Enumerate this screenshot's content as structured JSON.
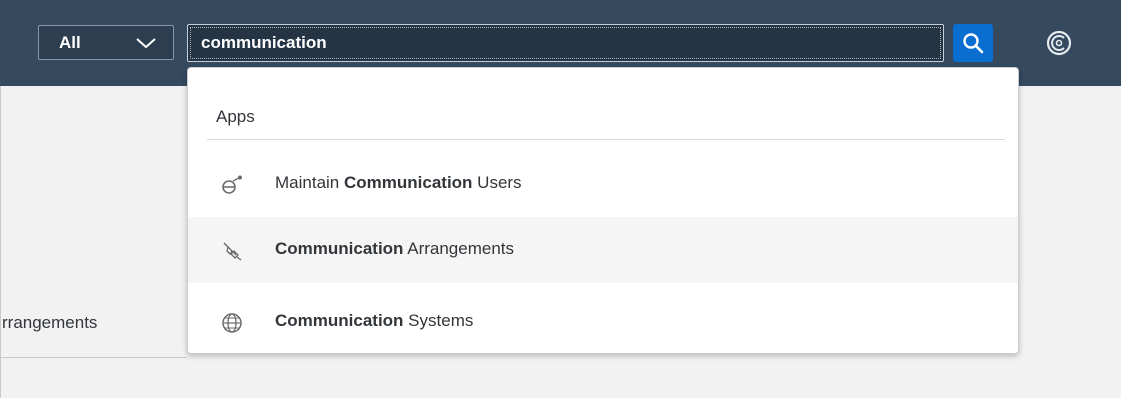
{
  "shellbar": {
    "scope": {
      "selected": "All"
    },
    "search": {
      "value": "communication"
    },
    "icons": {
      "scope_dropdown": "chevron-down-icon",
      "search_button": "search-icon",
      "assistant": "copilot-icon"
    }
  },
  "background": {
    "left_text": "rrangements"
  },
  "suggestions": {
    "group_label": "Apps",
    "items": [
      {
        "icon": "communication-user-icon",
        "prefix": "Maintain ",
        "match": "Communication",
        "suffix": " Users"
      },
      {
        "icon": "connection-icon",
        "prefix": "",
        "match": "Communication",
        "suffix": " Arrangements"
      },
      {
        "icon": "globe-icon",
        "prefix": "",
        "match": "Communication",
        "suffix": " Systems"
      }
    ]
  },
  "colors": {
    "shellbar": "#354a5f",
    "search_button": "#0a6ed1",
    "hover_row": "#f5f5f5"
  }
}
